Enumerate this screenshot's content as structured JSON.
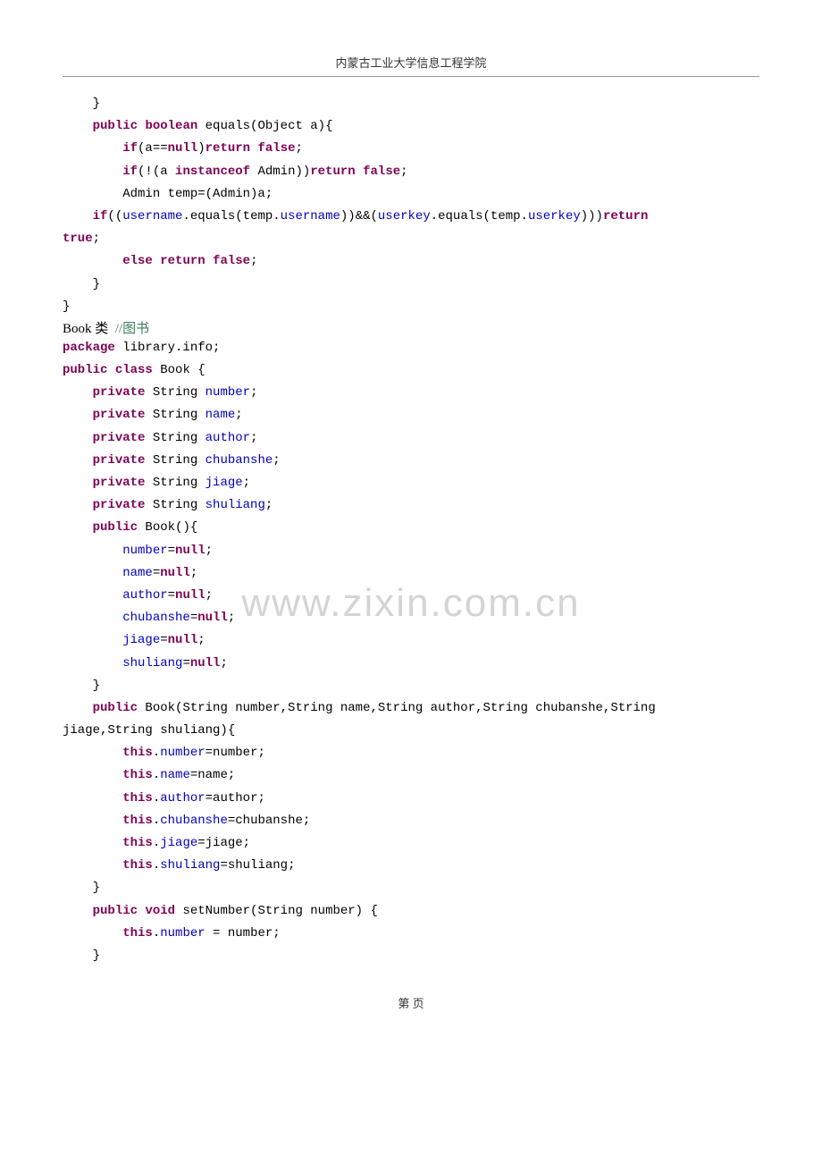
{
  "header": "内蒙古工业大学信息工程学院",
  "watermark": "www.zixin.com.cn",
  "footer": "第      页",
  "section": {
    "title_prefix": "Book 类",
    "title_comment": "  //图书"
  },
  "code": {
    "l1": "    }",
    "l2": "",
    "l3_1": "    ",
    "l3_public": "public",
    "l3_2": " ",
    "l3_boolean": "boolean",
    "l3_3": " equals(Object a){",
    "l4_1": "        ",
    "l4_if": "if",
    "l4_2": "(a==",
    "l4_null": "null",
    "l4_3": ")",
    "l4_return": "return",
    "l4_4": " ",
    "l4_false": "false",
    "l4_5": ";",
    "l5_1": "        ",
    "l5_if": "if",
    "l5_2": "(!(a ",
    "l5_instanceof": "instanceof",
    "l5_3": " Admin))",
    "l5_return": "return",
    "l5_4": " ",
    "l5_false": "false",
    "l5_5": ";",
    "l6": "        Admin temp=(Admin)a;",
    "l7": "",
    "l8_1": "    ",
    "l8_if": "if",
    "l8_2": "((",
    "l8_username": "username",
    "l8_3": ".equals(temp.",
    "l8_username2": "username",
    "l8_4": "))&&(",
    "l8_userkey": "userkey",
    "l8_5": ".equals(temp.",
    "l8_userkey2": "userkey",
    "l8_6": ")))",
    "l8_return": "return",
    "l9_true": "true",
    "l9_2": ";",
    "l10_1": "        ",
    "l10_else": "else",
    "l10_2": " ",
    "l10_return": "return",
    "l10_3": " ",
    "l10_false": "false",
    "l10_4": ";",
    "l11": "    }",
    "l12": "}",
    "p1_1": "package",
    "p1_2": " library.info;",
    "p2": "",
    "c1_public": "public",
    "c1_2": " ",
    "c1_class": "class",
    "c1_3": " Book {",
    "f1_1": "    ",
    "f1_private": "private",
    "f1_2": " String ",
    "f1_number": "number",
    "f1_3": ";",
    "f2_name": "name",
    "f3_author": "author",
    "f4_chubanshe": "chubanshe",
    "f5_jiage": "jiage",
    "f6_shuliang": "shuliang",
    "ctor1_1": "    ",
    "ctor1_public": "public",
    "ctor1_2": " Book(){",
    "ctor1_3": "        ",
    "ctor1_eq": "=",
    "ctor1_null": "null",
    "ctor1_semi": ";",
    "ctor1_close": "    }",
    "ctor2_1": "    ",
    "ctor2_public": "public",
    "ctor2_2": " Book(String number,String name,String author,String chubanshe,String",
    "ctor2_3": "jiage,String shuliang){",
    "a_1": "        ",
    "a_this": "this",
    "a_dot": ".",
    "a_eq_number": "=number;",
    "a_eq_name": "=name;",
    "a_eq_author": "=author;",
    "a_eq_chubanshe": "=chubanshe;",
    "a_eq_jiage": "=jiage;",
    "a_eq_shuliang": "=shuliang;",
    "ctor2_close": "    }",
    "set_1": "    ",
    "set_public": "public",
    "set_2": " ",
    "set_void": "void",
    "set_3": " setNumber(String number) {",
    "set_body_1": "        ",
    "set_body_this": "this",
    "set_body_2": ".",
    "set_body_number": "number",
    "set_body_3": " = number;",
    "set_close": "    }"
  }
}
